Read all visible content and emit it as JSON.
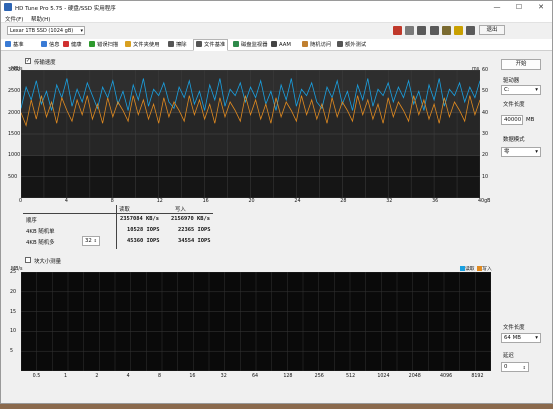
{
  "window": {
    "title": "HD Tune Pro 5.75 - 硬盘/SSD 实用程序",
    "min": "—",
    "max": "☐",
    "close": "✕"
  },
  "menu": [
    "文件(F)",
    "帮助(H)"
  ],
  "toolbar": {
    "drive": "Lexar 1TB SSD (1024 gB)",
    "exit": "退出",
    "icons": [
      {
        "name": "temperature-icon",
        "color": "#c0392b"
      },
      {
        "name": "copy-icon",
        "color": "#7a7a7a"
      },
      {
        "name": "screenshot-icon",
        "color": "#5a5a5a"
      },
      {
        "name": "camera-icon",
        "color": "#5a5a5a"
      },
      {
        "name": "save-icon",
        "color": "#7a6a30"
      },
      {
        "name": "key-icon",
        "color": "#c9a000"
      },
      {
        "name": "update-icon",
        "color": "#5a5a5a"
      }
    ]
  },
  "tabs": [
    {
      "label": "基准",
      "color": "#3a7bd5",
      "name": "tab-benchmark"
    },
    {
      "label": "信息",
      "color": "#3a7bd5",
      "name": "tab-info"
    },
    {
      "label": "健康",
      "color": "#d03030",
      "name": "tab-health"
    },
    {
      "label": "错误扫描",
      "color": "#2e9a2e",
      "name": "tab-error-scan"
    },
    {
      "label": "文件夹使用",
      "color": "#d8a020",
      "name": "tab-folder-usage"
    },
    {
      "label": "擦除",
      "color": "#555555",
      "name": "tab-erase"
    },
    {
      "label": "文件基准",
      "color": "#555555",
      "name": "tab-file-benchmark"
    },
    {
      "label": "磁盘监视器",
      "color": "#2e8a4a",
      "name": "tab-disk-monitor"
    },
    {
      "label": "AAM",
      "color": "#444444",
      "name": "tab-aam"
    },
    {
      "label": "随机访问",
      "color": "#c08030",
      "name": "tab-random-access"
    },
    {
      "label": "额外测试",
      "color": "#555555",
      "name": "tab-extra-tests"
    }
  ],
  "active_tab": "文件基准",
  "transfer": {
    "checkbox_label": "传输速度",
    "checked": true,
    "unit_left": "MB/s",
    "unit_right": "ms",
    "table": {
      "headers": [
        "读取",
        "写入"
      ],
      "rows": [
        {
          "label": "顺序",
          "read": "2357084 KB/s",
          "write": "2156970 KB/s"
        },
        {
          "label": "4KB 随机单",
          "read": "10528 IOPS",
          "write": "22365 IOPS"
        },
        {
          "label": "4KB 随机多",
          "read": "45360 IOPS",
          "write": "34554 IOPS"
        }
      ],
      "queue_depth": "32"
    }
  },
  "block": {
    "checkbox_label": "块大小测量",
    "checked": false,
    "unit_left": "MB/s",
    "legend_read": "读取",
    "legend_write": "写入"
  },
  "right_panel": {
    "start_button": "开始",
    "drive_label": "驱动器",
    "drive_value": "C:",
    "file_length_label": "文件长度",
    "file_length_value": "40000",
    "file_length_unit": "MB",
    "data_pattern_label": "数据模式",
    "data_pattern_value": "零",
    "file_length2_label": "文件长度",
    "file_length2_value": "64 MB",
    "delay_label": "延迟",
    "delay_value": "0"
  },
  "colors": {
    "read": "#1aa0e0",
    "write": "#e08a20"
  },
  "chart_data": [
    {
      "type": "line",
      "title": "",
      "xlabel": "",
      "ylabel": "MB/s",
      "xlim": [
        0,
        40
      ],
      "ylim": [
        0,
        3000
      ],
      "x_ticks": [
        "0",
        "4",
        "8",
        "12",
        "16",
        "20",
        "24",
        "28",
        "32",
        "36",
        "40gB"
      ],
      "y_ticks_left": [
        "3000",
        "2500",
        "2000",
        "1500",
        "1000",
        "500"
      ],
      "y_ticks_right": [
        "60",
        "50",
        "40",
        "30",
        "20",
        "10"
      ],
      "series": [
        {
          "name": "读取",
          "color": "#1aa0e0",
          "values": [
            2100,
            2600,
            2300,
            2750,
            2200,
            2500,
            2050,
            2650,
            2350,
            2800,
            2150,
            2550,
            2250,
            2700,
            2400,
            2100,
            2600,
            2350,
            2750,
            2200,
            2500,
            2050,
            2650,
            2300,
            2800,
            2150,
            2550,
            2400,
            2700,
            2250,
            2100,
            2600,
            2350,
            2750,
            2200,
            2500,
            2050,
            2650,
            2300,
            2800,
            2150,
            2550,
            2400,
            2700,
            2250,
            2600,
            2350,
            2750,
            2200,
            2500,
            2050,
            2650,
            2300,
            2800,
            2150,
            2550,
            2400,
            2700,
            2250,
            2100,
            2600,
            2350,
            2750,
            2200,
            2500,
            2050,
            2650,
            2300,
            2800,
            2150,
            2550,
            2400,
            2700,
            2250,
            2600,
            2350,
            2750,
            2200,
            2500,
            2050,
            2650,
            2300,
            2800,
            2150,
            2550,
            2400,
            2700,
            2250,
            2600,
            2350,
            2750
          ]
        },
        {
          "name": "写入",
          "color": "#e08a20",
          "values": [
            2000,
            1700,
            2300,
            1850,
            2400,
            1900,
            2250,
            1750,
            2350,
            2050,
            1800,
            2300,
            1950,
            2400,
            1850,
            2200,
            1750,
            2350,
            1900,
            2250,
            2050,
            1800,
            2400,
            1950,
            2300,
            1850,
            2200,
            1750,
            2350,
            1900,
            2250,
            2050,
            1800,
            2400,
            1950,
            2300,
            1850,
            2200,
            1750,
            2350,
            1900,
            2250,
            2050,
            1800,
            2400,
            1950,
            2300,
            1850,
            2200,
            1750,
            2350,
            1900,
            2250,
            2050,
            1800,
            2400,
            1950,
            2300,
            1850,
            2200,
            1750,
            2350,
            1900,
            2250,
            2050,
            1800,
            2400,
            1950,
            2300,
            1850,
            2200,
            1750,
            2350,
            1900,
            2250,
            2050,
            1800,
            2400,
            1950,
            2300,
            1850,
            2200,
            1750,
            2350,
            1900,
            2250,
            2050,
            1800,
            2400,
            1950,
            2300
          ]
        }
      ]
    },
    {
      "type": "bar",
      "title": "",
      "ylabel": "MB/s",
      "ylim": [
        0,
        25
      ],
      "y_ticks": [
        "25",
        "20",
        "15",
        "10",
        "5"
      ],
      "categories": [
        "0.5",
        "1",
        "2",
        "4",
        "8",
        "16",
        "32",
        "64",
        "128",
        "256",
        "512",
        "1024",
        "2048",
        "4096",
        "8192"
      ],
      "series": [
        {
          "name": "读取",
          "values": []
        },
        {
          "name": "写入",
          "values": []
        }
      ]
    }
  ]
}
